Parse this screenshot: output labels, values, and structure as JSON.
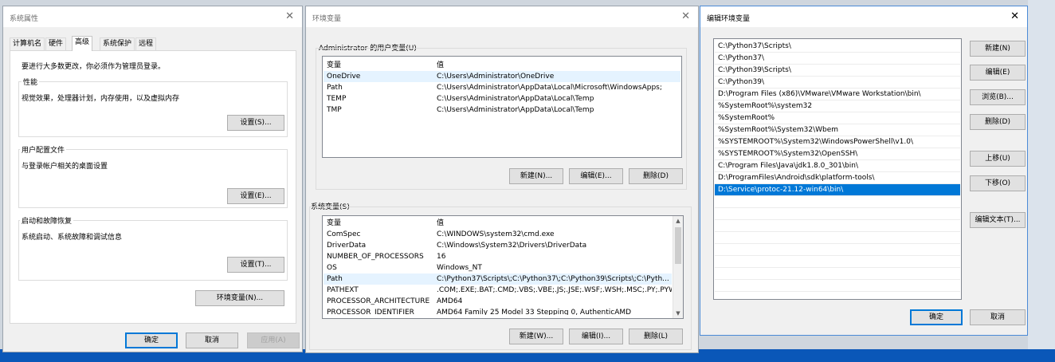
{
  "sysprops": {
    "title": "系统属性",
    "tabs": [
      "计算机名",
      "硬件",
      "高级",
      "系统保护",
      "远程"
    ],
    "admin_note": "要进行大多数更改，你必须作为管理员登录。",
    "perf": {
      "title": "性能",
      "desc": "视觉效果，处理器计划，内存使用，以及虚拟内存",
      "btn": "设置(S)..."
    },
    "profile": {
      "title": "用户配置文件",
      "desc": "与登录帐户相关的桌面设置",
      "btn": "设置(E)..."
    },
    "startup": {
      "title": "启动和故障恢复",
      "desc": "系统启动、系统故障和调试信息",
      "btn": "设置(T)..."
    },
    "env_btn": "环境变量(N)...",
    "ok": "确定",
    "cancel": "取消",
    "apply": "应用(A)"
  },
  "envvars": {
    "title": "环境变量",
    "user_group": "Administrator 的用户变量(U)",
    "col_var": "变量",
    "col_val": "值",
    "user_vars": [
      {
        "name": "OneDrive",
        "value": "C:\\Users\\Administrator\\OneDrive"
      },
      {
        "name": "Path",
        "value": "C:\\Users\\Administrator\\AppData\\Local\\Microsoft\\WindowsApps;"
      },
      {
        "name": "TEMP",
        "value": "C:\\Users\\Administrator\\AppData\\Local\\Temp"
      },
      {
        "name": "TMP",
        "value": "C:\\Users\\Administrator\\AppData\\Local\\Temp"
      }
    ],
    "user_new": "新建(N)...",
    "user_edit": "编辑(E)...",
    "user_delete": "删除(D)",
    "sys_group": "系统变量(S)",
    "sys_vars": [
      {
        "name": "ComSpec",
        "value": "C:\\WINDOWS\\system32\\cmd.exe"
      },
      {
        "name": "DriverData",
        "value": "C:\\Windows\\System32\\Drivers\\DriverData"
      },
      {
        "name": "NUMBER_OF_PROCESSORS",
        "value": "16"
      },
      {
        "name": "OS",
        "value": "Windows_NT"
      },
      {
        "name": "Path",
        "value": "C:\\Python37\\Scripts\\;C:\\Python37\\;C:\\Python39\\Scripts\\;C:\\Pyth..."
      },
      {
        "name": "PATHEXT",
        "value": ".COM;.EXE;.BAT;.CMD;.VBS;.VBE;.JS;.JSE;.WSF;.WSH;.MSC;.PY;.PYW"
      },
      {
        "name": "PROCESSOR_ARCHITECTURE",
        "value": "AMD64"
      },
      {
        "name": "PROCESSOR_IDENTIFIER",
        "value": "AMD64 Family 25 Model 33 Stepping 0, AuthenticAMD"
      }
    ],
    "sys_new": "新建(W)...",
    "sys_edit": "编辑(I)...",
    "sys_delete": "删除(L)"
  },
  "editenv": {
    "title": "编辑环境变量",
    "paths": [
      "C:\\Python37\\Scripts\\",
      "C:\\Python37\\",
      "C:\\Python39\\Scripts\\",
      "C:\\Python39\\",
      "D:\\Program Files (x86)\\VMware\\VMware Workstation\\bin\\",
      "%SystemRoot%\\system32",
      "%SystemRoot%",
      "%SystemRoot%\\System32\\Wbem",
      "%SYSTEMROOT%\\System32\\WindowsPowerShell\\v1.0\\",
      "%SYSTEMROOT%\\System32\\OpenSSH\\",
      "C:\\Program Files\\Java\\jdk1.8.0_301\\bin\\",
      "D:\\ProgramFiles\\Android\\sdk\\platform-tools\\",
      "D:\\Service\\protoc-21.12-win64\\bin\\"
    ],
    "selected_index": 12,
    "btn_new": "新建(N)",
    "btn_edit": "编辑(E)",
    "btn_browse": "浏览(B)...",
    "btn_delete": "删除(D)",
    "btn_up": "上移(U)",
    "btn_down": "下移(O)",
    "btn_edit_text": "编辑文本(T)...",
    "ok": "确定",
    "cancel": "取消"
  }
}
